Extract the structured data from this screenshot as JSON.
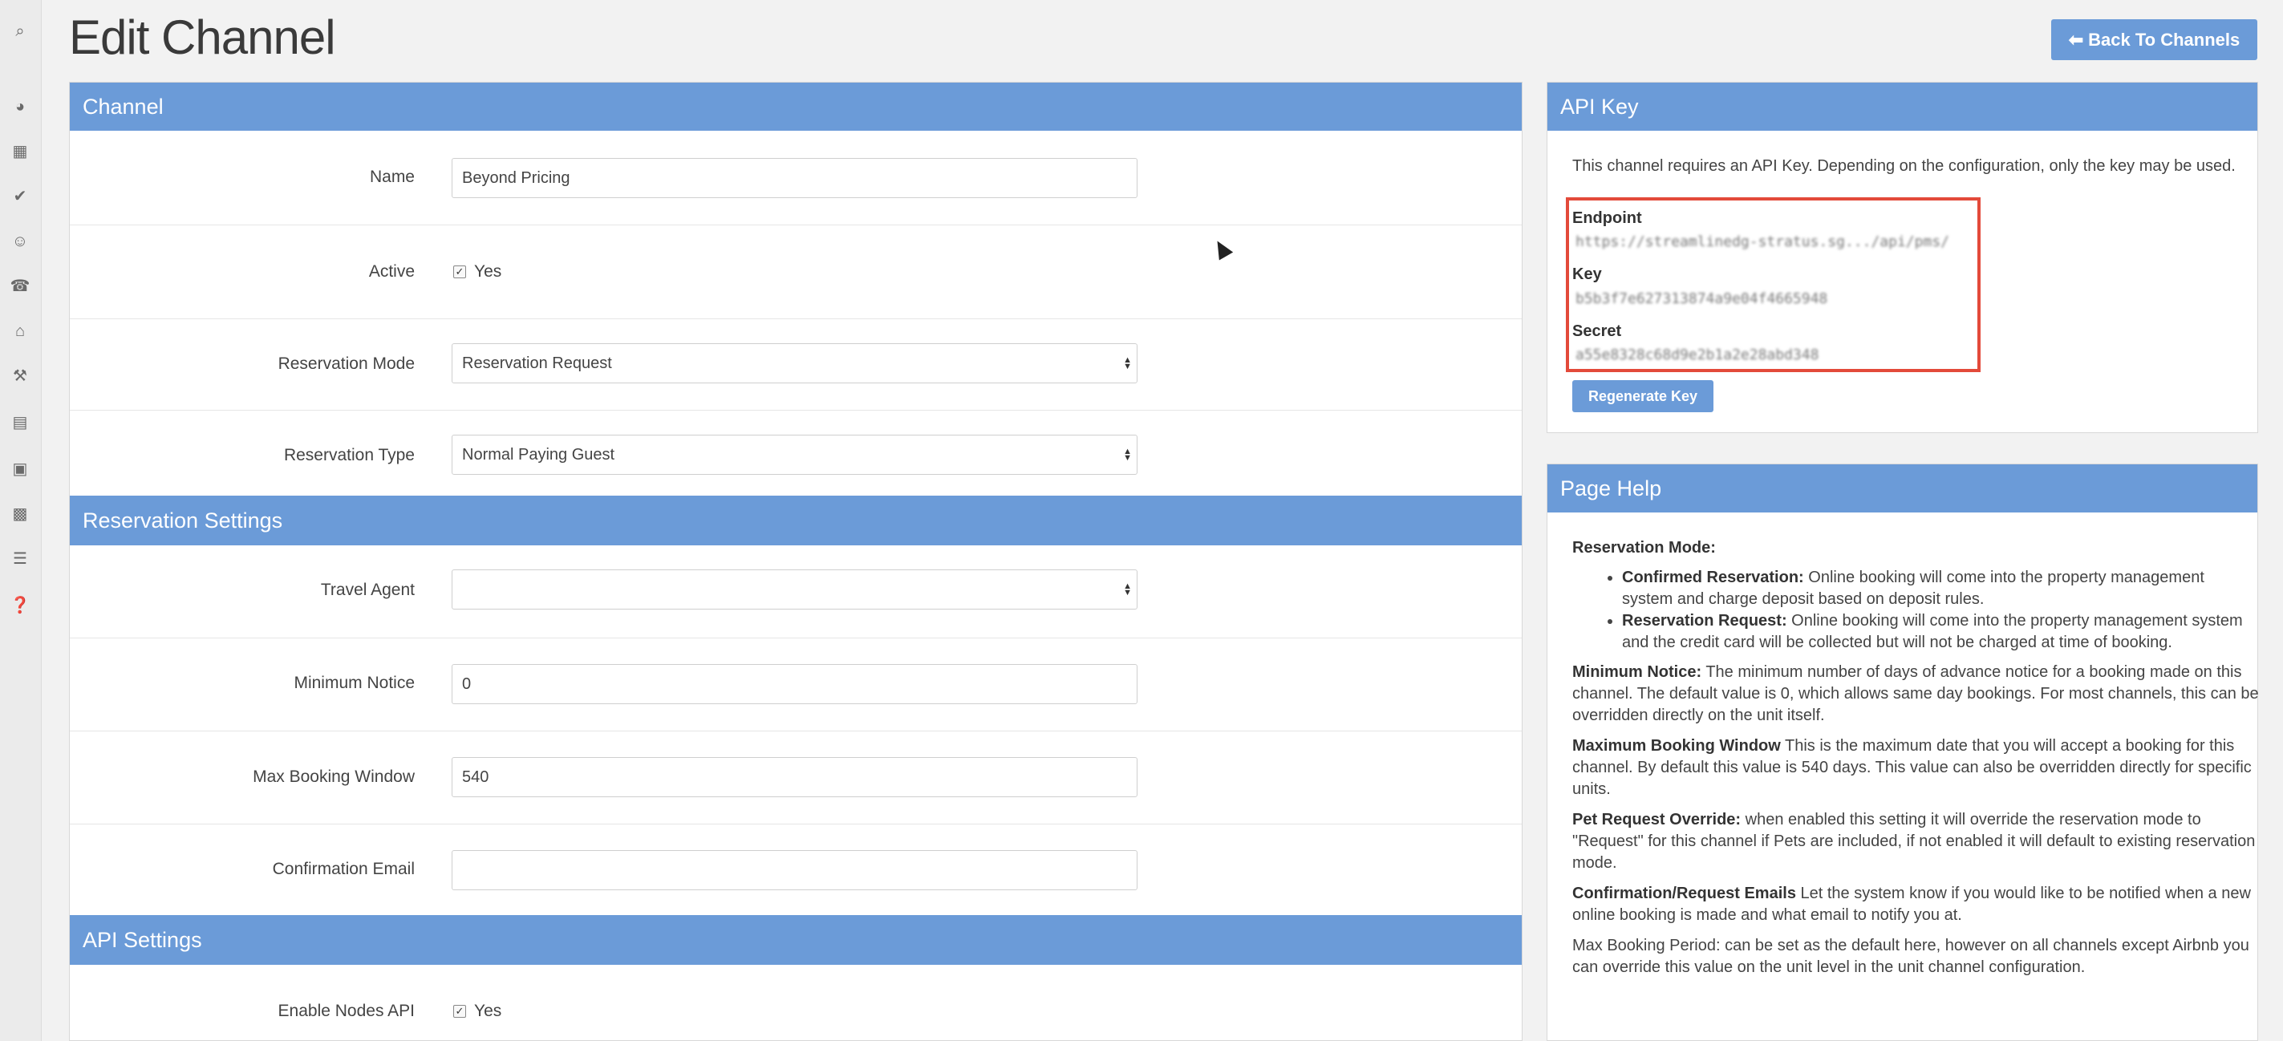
{
  "page": {
    "title": "Edit Channel",
    "back_button": "Back To Channels"
  },
  "rail_icons": [
    "search-icon",
    "dashboard-icon",
    "calendar-icon",
    "check-circle-icon",
    "users-icon",
    "phone-icon",
    "home-icon",
    "wrench-icon",
    "grid-icon",
    "money-icon",
    "briefcase-icon",
    "chart-icon",
    "help-icon"
  ],
  "channel": {
    "heading": "Channel",
    "name_label": "Name",
    "name_value": "Beyond Pricing",
    "active_label": "Active",
    "active_text": "Yes",
    "active_checked": true,
    "reservation_mode_label": "Reservation Mode",
    "reservation_mode_value": "Reservation Request",
    "reservation_type_label": "Reservation Type",
    "reservation_type_value": "Normal Paying Guest"
  },
  "reservation_settings": {
    "heading": "Reservation Settings",
    "travel_agent_label": "Travel Agent",
    "travel_agent_value": "",
    "min_notice_label": "Minimum Notice",
    "min_notice_value": "0",
    "max_window_label": "Max Booking Window",
    "max_window_value": "540",
    "confirmation_email_label": "Confirmation Email",
    "confirmation_email_value": ""
  },
  "api_settings": {
    "heading": "API Settings",
    "enable_nodes_label": "Enable Nodes API",
    "enable_nodes_text": "Yes",
    "enable_nodes_checked": true
  },
  "api_key": {
    "heading": "API Key",
    "intro": "This channel requires an API Key. Depending on the configuration, only the key may be used.",
    "endpoint_label": "Endpoint",
    "endpoint_value": "https://streamlinedg-stratus.sg.../api/pms/",
    "key_label": "Key",
    "key_value": "b5b3f7e627313874a9e04f4665948",
    "secret_label": "Secret",
    "secret_value": "a55e8328c68d9e2b1a2e28abd348",
    "regenerate_button": "Regenerate Key"
  },
  "page_help": {
    "heading": "Page Help",
    "reservation_mode_title": "Reservation Mode:",
    "confirmed_title": "Confirmed Reservation:",
    "confirmed_text": " Online booking will come into the property management system and charge deposit based on deposit rules.",
    "request_title": "Reservation Request:",
    "request_text": " Online booking will come into the property management system and the credit card will be collected but will not be charged at time of booking.",
    "min_notice_title": "Minimum Notice:",
    "min_notice_text": " The minimum number of days of advance notice for a booking made on this channel. The default value is 0, which allows same day bookings. For most channels, this can be overridden directly on the unit itself.",
    "max_window_title": "Maximum Booking Window",
    "max_window_text": " This is the maximum date that you will accept a booking for this channel. By default this value is 540 days. This value can also be overridden directly for specific units.",
    "pet_title": "Pet Request Override:",
    "pet_text": " when enabled this setting it will override the reservation mode to \"Request\" for this channel if Pets are included, if not enabled it will default to existing reservation mode.",
    "emails_title": "Confirmation/Request Emails",
    "emails_text": " Let the system know if you would like to be notified when a new online booking is made and what email to notify you at.",
    "max_period_text": "Max Booking Period: can be set as the default here, however on all channels except Airbnb you can override this value on the unit level in the unit channel configuration."
  }
}
